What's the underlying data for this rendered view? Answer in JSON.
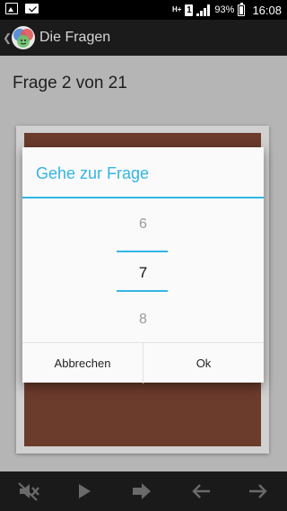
{
  "status_bar": {
    "network": "H+",
    "sim": "1",
    "battery": "93%",
    "time": "16:08",
    "left_icons": [
      "image-icon",
      "mail-icon"
    ]
  },
  "action_bar": {
    "title": "Die Fragen",
    "back_icon": "chevron-left-icon",
    "logo_icon": "app-logo-icon"
  },
  "main": {
    "question_counter": "Frage 2 von 21"
  },
  "dialog": {
    "title": "Gehe zur Frage",
    "picker": {
      "prev": "6",
      "current": "7",
      "next": "8"
    },
    "cancel_label": "Abbrechen",
    "ok_label": "Ok"
  },
  "bottom_bar": {
    "buttons": [
      "mute-icon",
      "play-icon",
      "next-icon",
      "arrow-left-icon",
      "arrow-right-icon"
    ]
  },
  "colors": {
    "accent": "#33b5e5",
    "card": "#6b3b2c",
    "background": "#b5b5b5"
  }
}
